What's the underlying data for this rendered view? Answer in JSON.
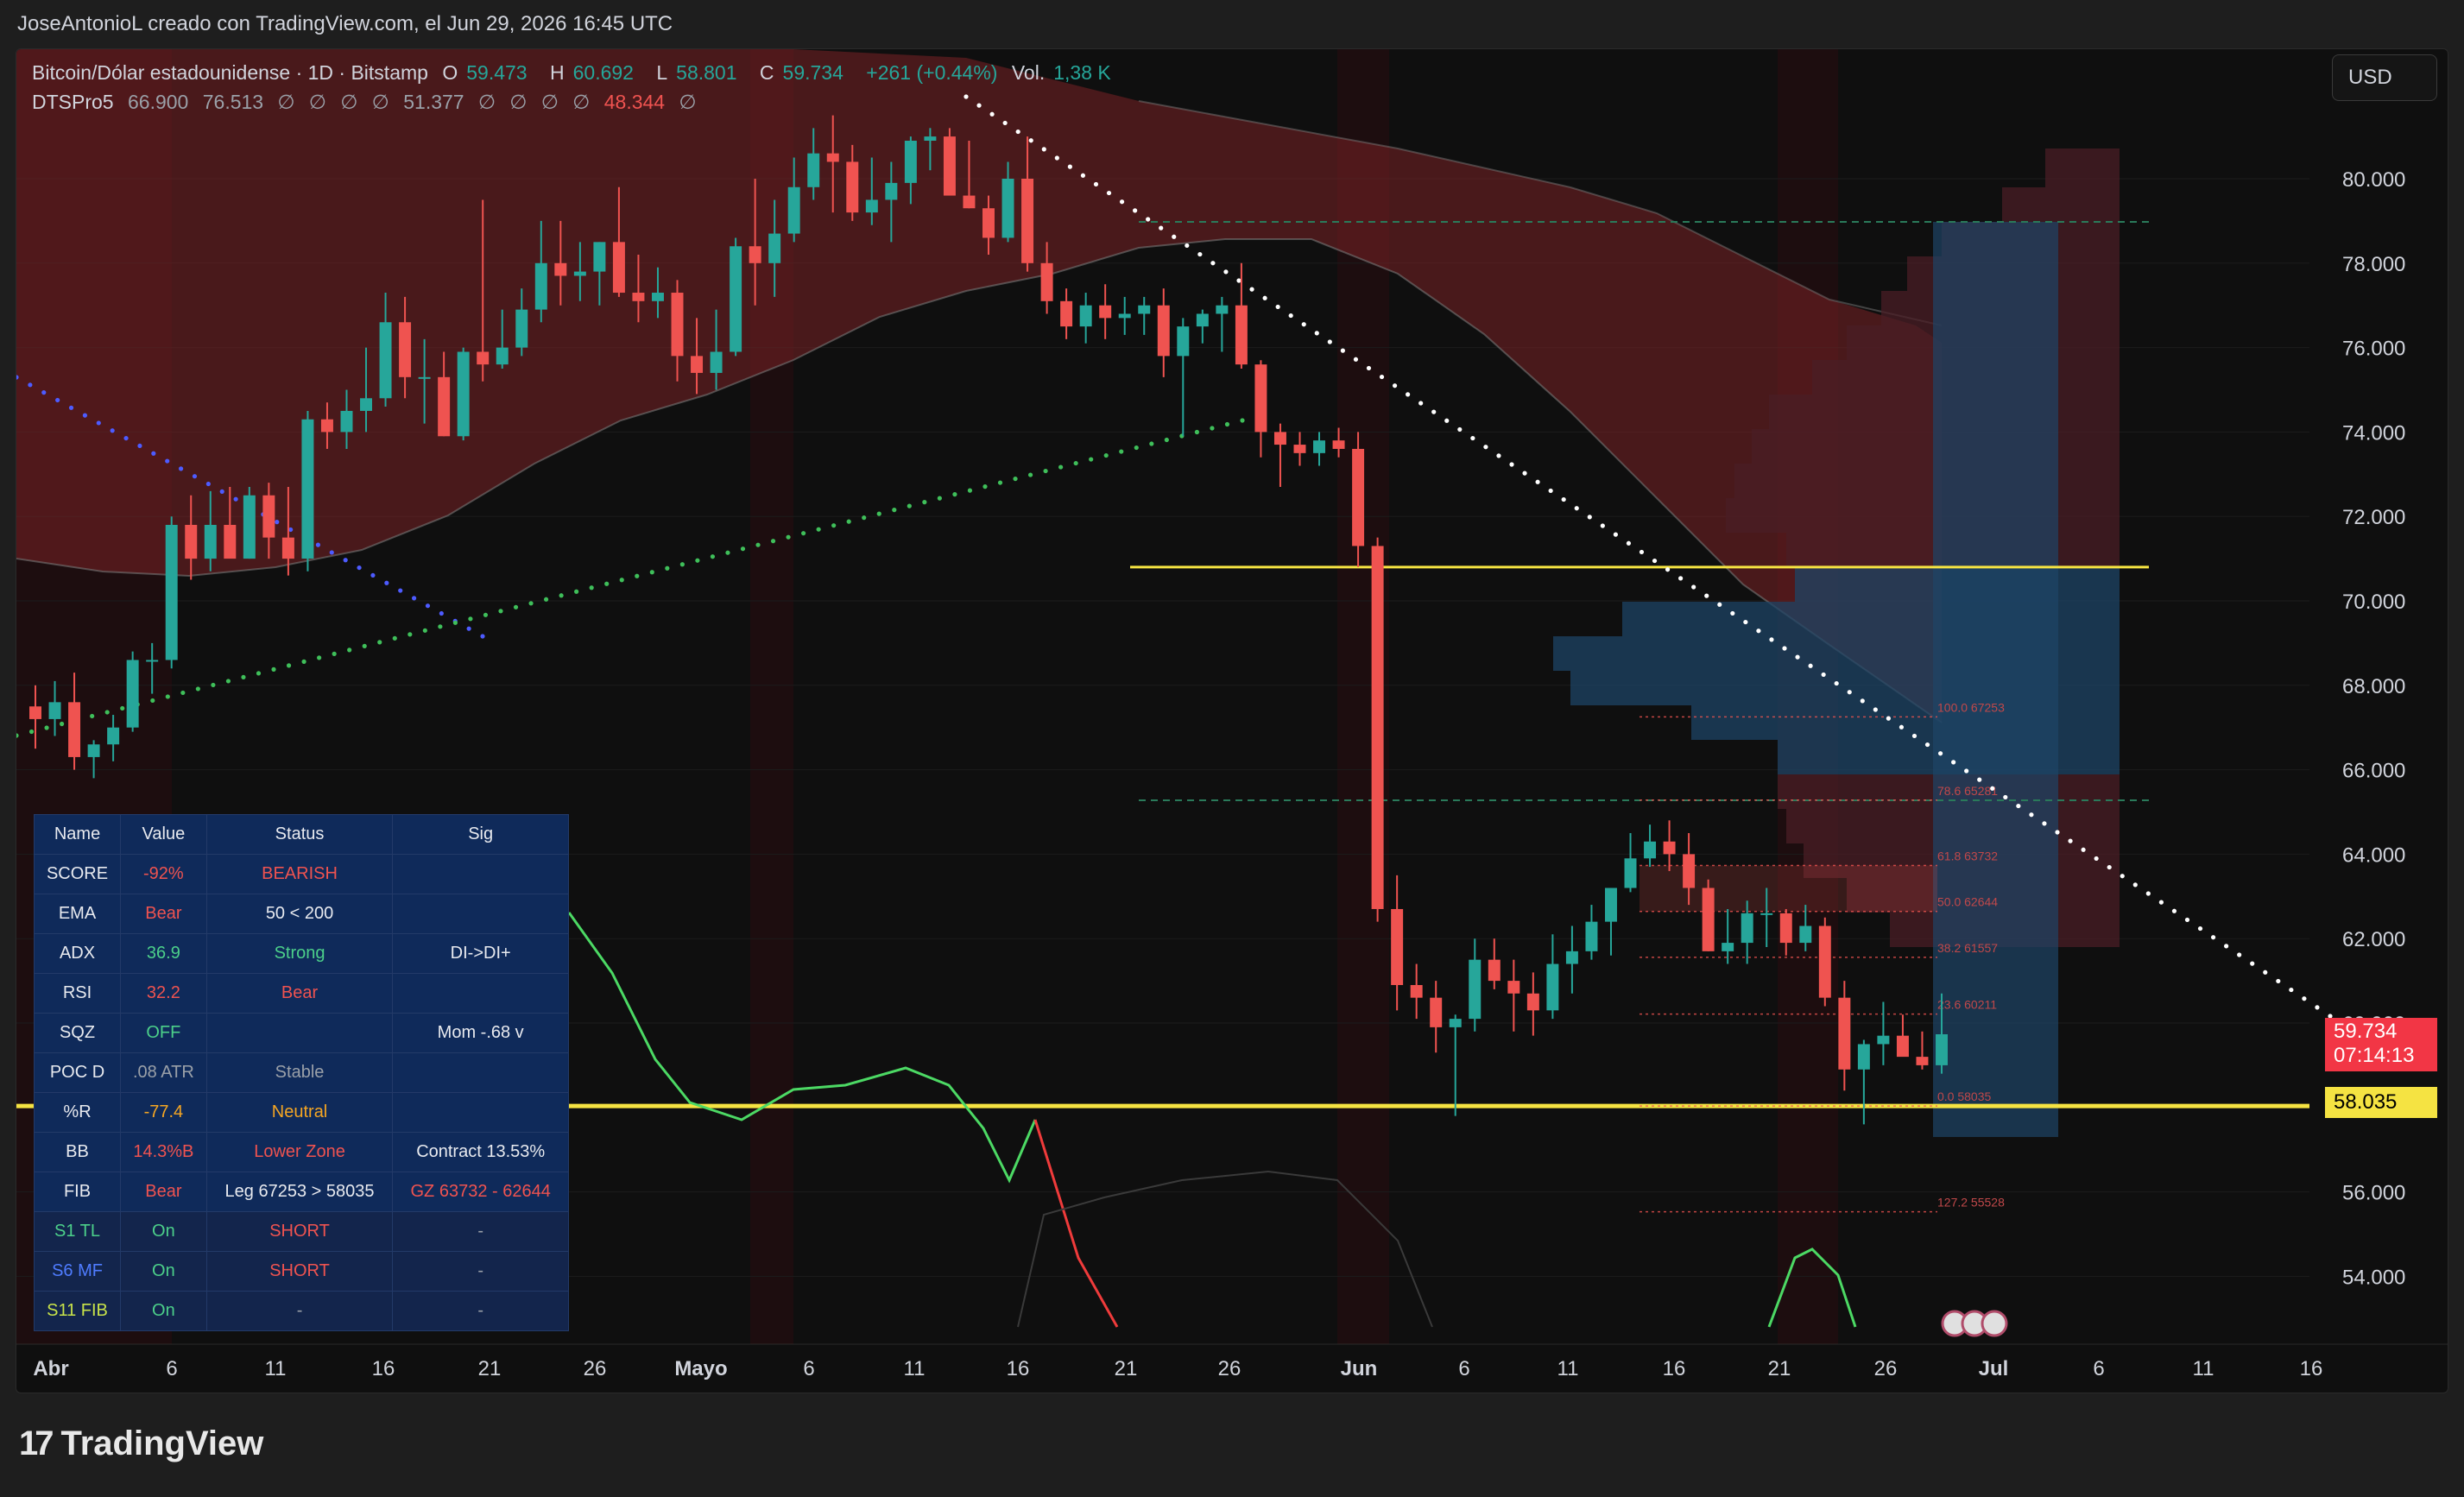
{
  "header": {
    "attribution": "JoseAntonioL creado con TradingView.com, el Jun 29, 2026 16:45 UTC"
  },
  "legend": {
    "symbol": "Bitcoin/Dólar estadounidense · 1D · Bitstamp",
    "open_label": "O",
    "open": "59.473",
    "high_label": "H",
    "high": "60.692",
    "low_label": "L",
    "low": "58.801",
    "close_label": "C",
    "close": "59.734",
    "change": "+261 (+0.44%)",
    "vol_label": "Vol.",
    "vol": "1,38 K",
    "indicator": "DTSPro5",
    "ind_v1": "66.900",
    "ind_v2": "76.513",
    "ind_v3": "51.377",
    "ind_v4": "48.344",
    "empty_glyph": "∅"
  },
  "currency_button": "USD",
  "price_tags": {
    "last_price": "59.734",
    "countdown": "07:14:13",
    "support": "58.035"
  },
  "colors": {
    "up": "#26a69a",
    "down": "#ef5350",
    "band": "#7a2326",
    "vpvr_up": "#1e4466",
    "vpvr_down": "#4a1e26",
    "yellow": "#f5e342",
    "bg": "#0f0f0f"
  },
  "info_table": {
    "headers": [
      "Name",
      "Value",
      "Status",
      "Sig"
    ],
    "rows": [
      {
        "name": "SCORE",
        "value": "-92%",
        "status": "BEARISH",
        "sig": ""
      },
      {
        "name": "EMA",
        "value": "Bear",
        "status": "50 < 200",
        "sig": ""
      },
      {
        "name": "ADX",
        "value": "36.9",
        "status": "Strong",
        "sig": "DI->DI+"
      },
      {
        "name": "RSI",
        "value": "32.2",
        "status": "Bear",
        "sig": ""
      },
      {
        "name": "SQZ",
        "value": "OFF",
        "status": "",
        "sig": "Mom -.68 v"
      },
      {
        "name": "POC D",
        "value": ".08 ATR",
        "status": "Stable",
        "sig": ""
      },
      {
        "name": "%R",
        "value": "-77.4",
        "status": "Neutral",
        "sig": ""
      },
      {
        "name": "BB",
        "value": "14.3%B",
        "status": "Lower Zone",
        "sig": "Contract 13.53%"
      },
      {
        "name": "FIB",
        "value": "Bear",
        "status": "Leg 67253 > 58035",
        "sig": "GZ 63732 - 62644"
      },
      {
        "name": "S1 TL",
        "value": "On",
        "status": "SHORT",
        "sig": "-"
      },
      {
        "name": "S6 MF",
        "value": "On",
        "status": "SHORT",
        "sig": "-"
      },
      {
        "name": "S11 FIB",
        "value": "On",
        "status": "-",
        "sig": "-"
      }
    ]
  },
  "chart_data": {
    "type": "candlestick",
    "x_axis_labels": [
      "Abr",
      "6",
      "11",
      "16",
      "21",
      "26",
      "Mayo",
      "6",
      "11",
      "16",
      "21",
      "26",
      "Jun",
      "6",
      "11",
      "16",
      "21",
      "26",
      "Jul",
      "6",
      "11",
      "16"
    ],
    "y_axis_labels": [
      "80.000",
      "78.000",
      "76.000",
      "74.000",
      "72.000",
      "70.000",
      "68.000",
      "66.000",
      "64.000",
      "62.000",
      "60.000",
      "56.000",
      "54.000"
    ],
    "ylim": [
      52000,
      82000
    ],
    "candles": [
      [
        67500,
        68000,
        66500,
        67200
      ],
      [
        67200,
        68100,
        66800,
        67600
      ],
      [
        67600,
        68300,
        66000,
        66300
      ],
      [
        66300,
        66700,
        65800,
        66600
      ],
      [
        66600,
        67300,
        66200,
        67000
      ],
      [
        67000,
        68800,
        66900,
        68600
      ],
      [
        68600,
        69000,
        67800,
        68600
      ],
      [
        68600,
        72000,
        68400,
        71800
      ],
      [
        71800,
        72500,
        70500,
        71000
      ],
      [
        71000,
        72600,
        70700,
        71800
      ],
      [
        71800,
        72700,
        71300,
        71000
      ],
      [
        71000,
        72700,
        71000,
        72500
      ],
      [
        72500,
        72800,
        71000,
        71500
      ],
      [
        71500,
        72700,
        70600,
        71000
      ],
      [
        71000,
        74500,
        70700,
        74300
      ],
      [
        74300,
        74700,
        73600,
        74000
      ],
      [
        74000,
        75000,
        73600,
        74500
      ],
      [
        74500,
        76000,
        74000,
        74800
      ],
      [
        74800,
        77300,
        74600,
        76600
      ],
      [
        76600,
        77200,
        74800,
        75300
      ],
      [
        75300,
        76200,
        74200,
        75300
      ],
      [
        75300,
        75900,
        73900,
        73900
      ],
      [
        73900,
        76000,
        73800,
        75900
      ],
      [
        75900,
        79500,
        75200,
        75600
      ],
      [
        75600,
        76900,
        75500,
        76000
      ],
      [
        76000,
        77400,
        75800,
        76900
      ],
      [
        76900,
        79000,
        76600,
        78000
      ],
      [
        78000,
        79000,
        77000,
        77700
      ],
      [
        77700,
        78500,
        77100,
        77800
      ],
      [
        77800,
        78500,
        77000,
        78500
      ],
      [
        78500,
        79800,
        77200,
        77300
      ],
      [
        77300,
        78200,
        76600,
        77100
      ],
      [
        77100,
        77900,
        76700,
        77300
      ],
      [
        77300,
        77600,
        75200,
        75800
      ],
      [
        75800,
        76700,
        74900,
        75400
      ],
      [
        75400,
        76900,
        75000,
        75900
      ],
      [
        75900,
        78600,
        75800,
        78400
      ],
      [
        78400,
        80000,
        77000,
        78000
      ],
      [
        78000,
        79500,
        77200,
        78700
      ],
      [
        78700,
        80500,
        78500,
        79800
      ],
      [
        79800,
        81200,
        79500,
        80600
      ],
      [
        80600,
        81500,
        79200,
        80400
      ],
      [
        80400,
        80800,
        79000,
        79200
      ],
      [
        79200,
        80500,
        78900,
        79500
      ],
      [
        79500,
        80400,
        78500,
        79900
      ],
      [
        79900,
        81000,
        79400,
        80900
      ],
      [
        80900,
        81200,
        80200,
        81000
      ],
      [
        81000,
        81200,
        79800,
        79600
      ],
      [
        79600,
        80900,
        79300,
        79300
      ],
      [
        79300,
        79600,
        78200,
        78600
      ],
      [
        78600,
        80400,
        78500,
        80000
      ],
      [
        80000,
        81000,
        77800,
        78000
      ],
      [
        78000,
        78500,
        76800,
        77100
      ],
      [
        77100,
        77400,
        76200,
        76500
      ],
      [
        76500,
        77300,
        76100,
        77000
      ],
      [
        77000,
        77500,
        76200,
        76700
      ],
      [
        76700,
        77200,
        76300,
        76800
      ],
      [
        76800,
        77200,
        76300,
        77000
      ],
      [
        77000,
        77400,
        75300,
        75800
      ],
      [
        75800,
        76700,
        73900,
        76500
      ],
      [
        76500,
        76900,
        76100,
        76800
      ],
      [
        76800,
        77200,
        75900,
        77000
      ],
      [
        77000,
        78000,
        75500,
        75600
      ],
      [
        75600,
        75700,
        73400,
        74000
      ],
      [
        74000,
        74200,
        72700,
        73700
      ],
      [
        73700,
        74000,
        73200,
        73500
      ],
      [
        73500,
        74000,
        73200,
        73800
      ],
      [
        73800,
        74100,
        73400,
        73600
      ],
      [
        73600,
        74000,
        70800,
        71300
      ],
      [
        71300,
        71500,
        62400,
        62700
      ],
      [
        62700,
        63500,
        60300,
        60900
      ],
      [
        60900,
        61400,
        60100,
        60600
      ],
      [
        60600,
        61000,
        59300,
        59900
      ],
      [
        59900,
        60200,
        57800,
        60100
      ],
      [
        60100,
        62000,
        59800,
        61500
      ],
      [
        61500,
        62000,
        60800,
        61000
      ],
      [
        61000,
        61500,
        59800,
        60700
      ],
      [
        60700,
        61200,
        59700,
        60300
      ],
      [
        60300,
        62100,
        60100,
        61400
      ],
      [
        61400,
        62300,
        60700,
        61700
      ],
      [
        61700,
        62800,
        61500,
        62400
      ],
      [
        62400,
        63200,
        61600,
        63200
      ],
      [
        63200,
        64500,
        63100,
        63900
      ],
      [
        63900,
        64700,
        63700,
        64300
      ],
      [
        64300,
        64800,
        63600,
        64000
      ],
      [
        64000,
        64500,
        62800,
        63200
      ],
      [
        63200,
        63400,
        61700,
        61700
      ],
      [
        61700,
        62700,
        61400,
        61900
      ],
      [
        61900,
        62900,
        61400,
        62600
      ],
      [
        62600,
        63200,
        61800,
        62600
      ],
      [
        62600,
        62700,
        61600,
        61900
      ],
      [
        61900,
        62800,
        61700,
        62300
      ],
      [
        62300,
        62500,
        60400,
        60600
      ],
      [
        60600,
        61000,
        58400,
        58900
      ],
      [
        58900,
        59600,
        57600,
        59500
      ],
      [
        59500,
        60500,
        59000,
        59700
      ],
      [
        59700,
        60200,
        59300,
        59200
      ],
      [
        59200,
        59800,
        58900,
        59000
      ],
      [
        59000,
        60700,
        58800,
        59734
      ]
    ],
    "horizontal_levels": [
      {
        "value": 70800,
        "label": "",
        "color": "#f5e342"
      },
      {
        "value": 58035,
        "label": "58.035",
        "color": "#f5e342"
      }
    ],
    "fib_levels": [
      {
        "label": "100.0  67253",
        "value": 67253
      },
      {
        "label": "78.6  65281",
        "value": 65281
      },
      {
        "label": "61.8  63732",
        "value": 63732
      },
      {
        "label": "50.0  62644",
        "value": 62644
      },
      {
        "label": "38.2  61557",
        "value": 61557
      },
      {
        "label": "23.6  60211",
        "value": 60211
      },
      {
        "label": "0.0  58035",
        "value": 58035
      },
      {
        "label": "127.2  55528",
        "value": 55528
      }
    ]
  }
}
